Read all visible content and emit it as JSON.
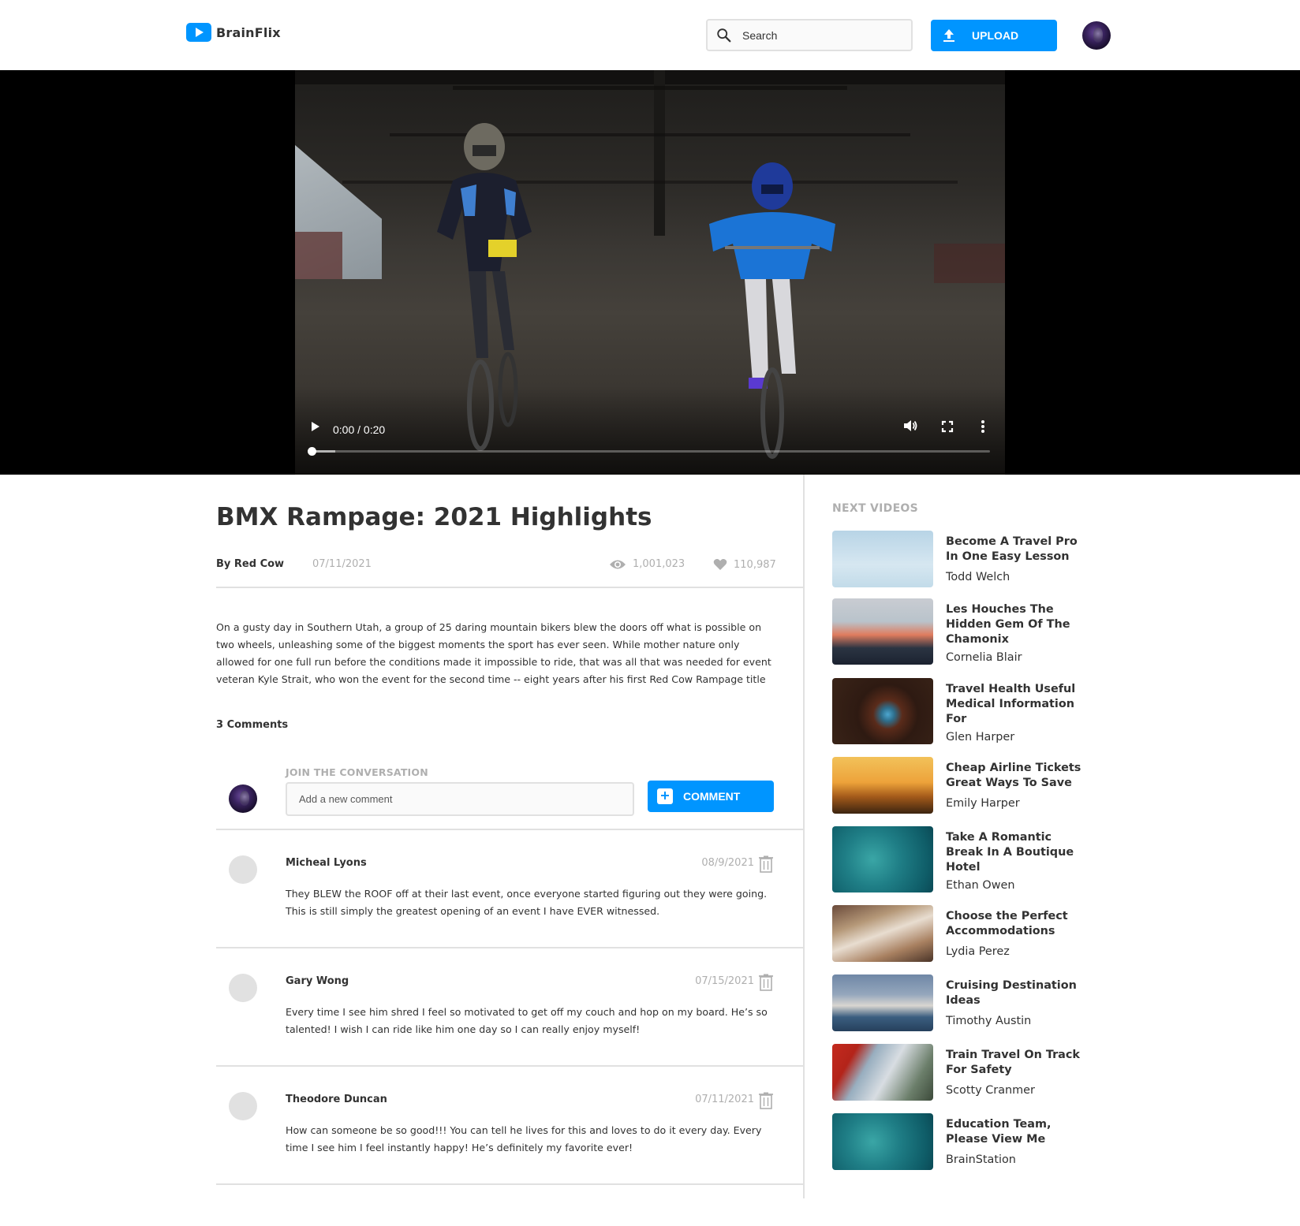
{
  "header": {
    "logo_text": "BrainFlix",
    "search_placeholder": "Search",
    "upload_label": "UPLOAD",
    "brand_color": "#0095FF"
  },
  "video": {
    "time": "0:00 / 0:20",
    "progress": 0.0
  },
  "main": {
    "title": "BMX Rampage: 2021 Highlights",
    "byline": "By Red Cow",
    "date": "07/11/2021",
    "views": "1,001,023",
    "likes": "110,987",
    "description": "On a gusty day in Southern Utah, a group of 25 daring mountain bikers blew the doors off what is possible on two wheels, unleashing some of the biggest moments the sport has ever seen. While mother nature only allowed for one full run before the conditions made it impossible to ride, that was all that was needed for event veteran Kyle Strait, who won the event for the second time -- eight years after his first Red Cow Rampage title",
    "comments_count": "3 Comments"
  },
  "comment_form": {
    "label": "JOIN THE CONVERSATION",
    "placeholder": "Add a new comment",
    "button_label": "COMMENT"
  },
  "comments": [
    {
      "name": "Micheal Lyons",
      "date": "08/9/2021",
      "text": "They BLEW the ROOF off at their last event, once everyone started figuring out they were going. This is still simply the greatest opening of an event I have EVER witnessed."
    },
    {
      "name": "Gary Wong",
      "date": "07/15/2021",
      "text": "Every time I see him shred I feel so motivated to get off my couch and hop on my board. He’s so talented! I wish I can ride like him one day so I can really enjoy myself!"
    },
    {
      "name": "Theodore Duncan",
      "date": "07/11/2021",
      "text": "How can someone be so good!!! You can tell he lives for this and loves to do it every day. Every time I see him I feel instantly happy! He’s definitely my favorite ever!"
    }
  ],
  "sidebar": {
    "title": "NEXT VIDEOS",
    "videos": [
      {
        "title": "Become A Travel Pro In One Easy Lesson",
        "author": "Todd Welch"
      },
      {
        "title": "Les Houches The Hidden Gem Of The Chamonix",
        "author": "Cornelia Blair"
      },
      {
        "title": "Travel Health Useful Medical Information For",
        "author": "Glen Harper"
      },
      {
        "title": "Cheap Airline Tickets Great Ways To Save",
        "author": "Emily Harper"
      },
      {
        "title": "Take A Romantic Break In A Boutique Hotel",
        "author": "Ethan Owen"
      },
      {
        "title": "Choose the Perfect Accommodations",
        "author": "Lydia Perez"
      },
      {
        "title": "Cruising Destination Ideas",
        "author": "Timothy Austin"
      },
      {
        "title": "Train Travel On Track For Safety",
        "author": "Scotty Cranmer"
      },
      {
        "title": "Education Team, Please View Me",
        "author": "BrainStation"
      }
    ]
  }
}
